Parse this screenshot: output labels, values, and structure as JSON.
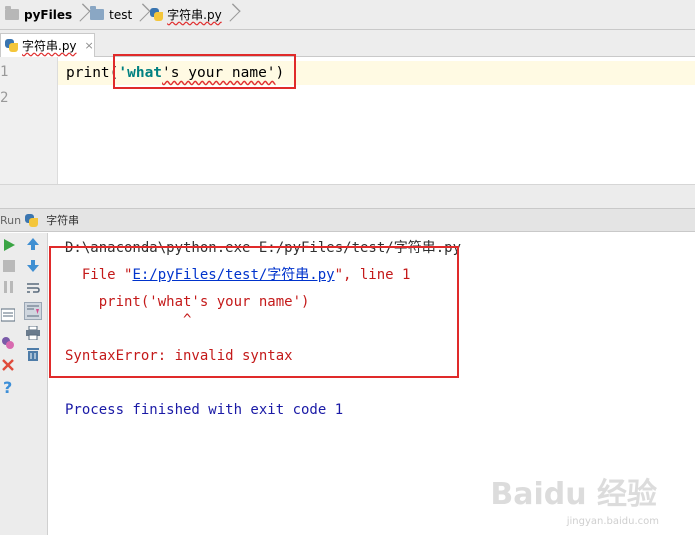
{
  "breadcrumb": {
    "project": "pyFiles",
    "folder": "test",
    "file": "字符串.py"
  },
  "editor_tab": {
    "label": "字符串.py",
    "close": "×"
  },
  "editor": {
    "line_numbers": [
      "1",
      "2"
    ],
    "code_prefix": "print(",
    "code_quote_word": "'what",
    "code_rest": "'s your name'",
    "code_suffix": ")"
  },
  "run_panel": {
    "label": "Run",
    "config": "字符串"
  },
  "console": {
    "cmd": "D:\\anaconda\\python.exe E:/pyFiles/test/字符串.py",
    "file_prefix": "  File \"",
    "file_link": "E:/pyFiles/test/字符串.py",
    "file_suffix": "\", line 1",
    "src_line": "    print('what's your name')",
    "caret": "              ^",
    "error": "SyntaxError: invalid syntax",
    "exit": "Process finished with exit code 1"
  },
  "watermark": {
    "brand": "Baidu 经验",
    "url": "jingyan.baidu.com"
  },
  "colors": {
    "annotation_red": "#e02a2a",
    "console_red": "#c41a1a",
    "console_blue": "#1a1aa6",
    "link_blue": "#0033cc",
    "string_teal": "#008080"
  }
}
